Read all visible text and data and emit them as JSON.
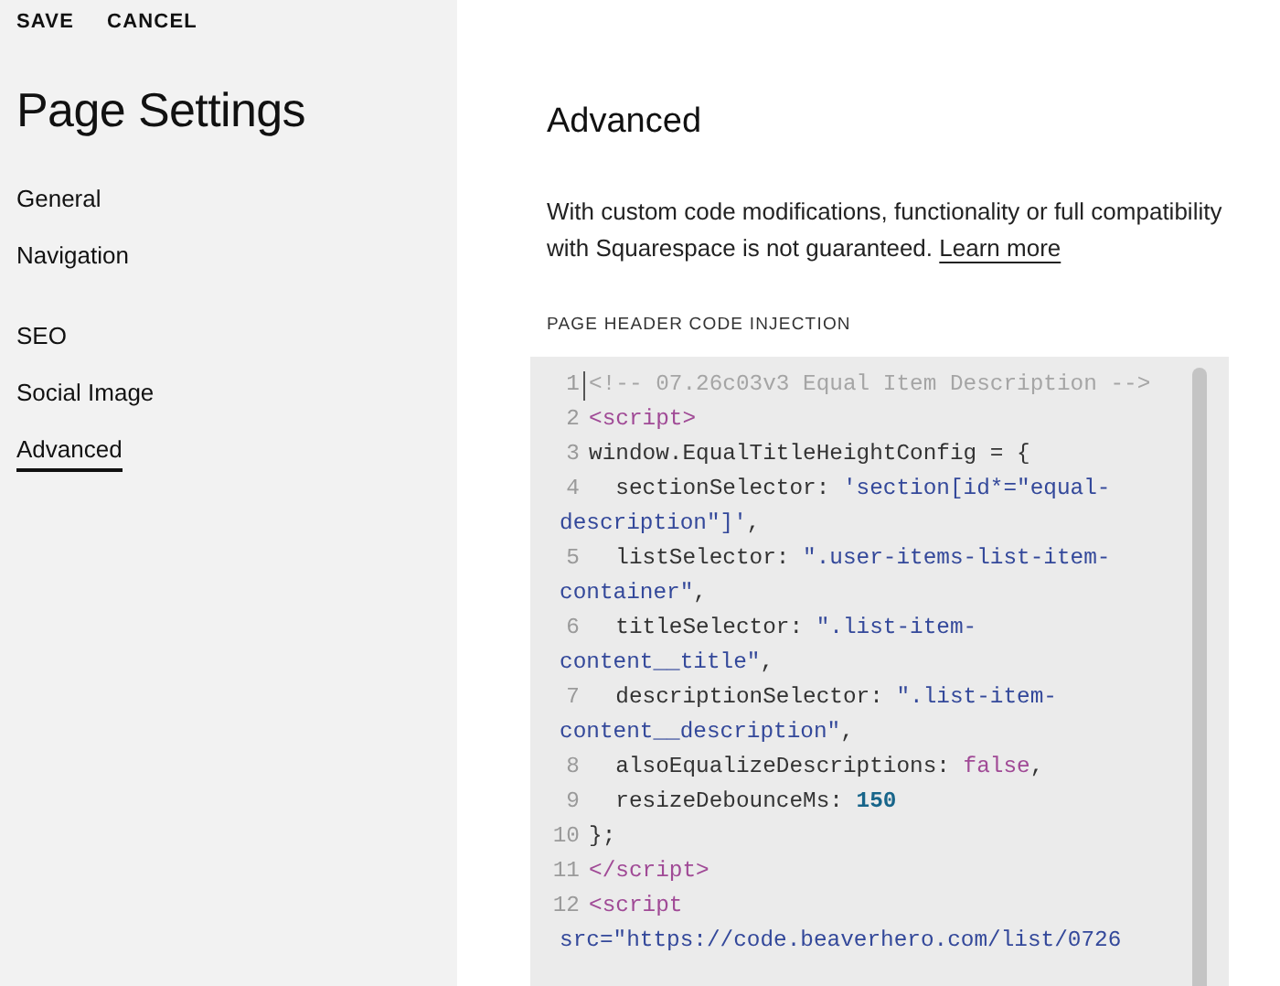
{
  "sidebar": {
    "actions": [
      "SAVE",
      "CANCEL"
    ],
    "title": "Page Settings",
    "groups": [
      [
        {
          "label": "General",
          "selected": false
        },
        {
          "label": "Navigation",
          "selected": false
        }
      ],
      [
        {
          "label": "SEO",
          "selected": false
        },
        {
          "label": "Social Image",
          "selected": false
        },
        {
          "label": "Advanced",
          "selected": true
        }
      ]
    ]
  },
  "main": {
    "title": "Advanced",
    "description": "With custom code modifications, functionality or full compatibility with Squarespace is not guaranteed.",
    "link": "Learn more",
    "section_label": "PAGE HEADER CODE INJECTION",
    "code": [
      {
        "number": "1",
        "rows": [
          {
            "tokens": [
              {
                "kind": "comment",
                "text": "<!-- 07.26c03v3 Equal Item Description -->"
              }
            ]
          }
        ]
      },
      {
        "number": "2",
        "rows": [
          {
            "tokens": [
              {
                "kind": "tag",
                "text": "<script>"
              }
            ]
          }
        ]
      },
      {
        "number": "3",
        "rows": [
          {
            "tokens": [
              {
                "kind": "plain",
                "text": "window.EqualTitleHeightConfig = {"
              }
            ]
          }
        ]
      },
      {
        "number": "4",
        "rows": [
          {
            "tokens": [
              {
                "kind": "plain",
                "text": "  sectionSelector: "
              },
              {
                "kind": "string",
                "text": "'section[id*=\"equal-"
              }
            ]
          },
          {
            "tokens": [
              {
                "kind": "string",
                "text": "description\"]'"
              },
              {
                "kind": "plain",
                "text": ","
              }
            ]
          }
        ]
      },
      {
        "number": "5",
        "rows": [
          {
            "tokens": [
              {
                "kind": "plain",
                "text": "  listSelector: "
              },
              {
                "kind": "string",
                "text": "\".user-items-list-item-"
              }
            ]
          },
          {
            "tokens": [
              {
                "kind": "string",
                "text": "container\""
              },
              {
                "kind": "plain",
                "text": ","
              }
            ]
          }
        ]
      },
      {
        "number": "6",
        "rows": [
          {
            "tokens": [
              {
                "kind": "plain",
                "text": "  titleSelector: "
              },
              {
                "kind": "string",
                "text": "\".list-item-"
              }
            ]
          },
          {
            "tokens": [
              {
                "kind": "string",
                "text": "content__title\""
              },
              {
                "kind": "plain",
                "text": ","
              }
            ]
          }
        ]
      },
      {
        "number": "7",
        "rows": [
          {
            "tokens": [
              {
                "kind": "plain",
                "text": "  descriptionSelector: "
              },
              {
                "kind": "string",
                "text": "\".list-item-"
              }
            ]
          },
          {
            "tokens": [
              {
                "kind": "string",
                "text": "content__description\""
              },
              {
                "kind": "plain",
                "text": ","
              }
            ]
          }
        ]
      },
      {
        "number": "8",
        "rows": [
          {
            "tokens": [
              {
                "kind": "plain",
                "text": "  alsoEqualizeDescriptions: "
              },
              {
                "kind": "keyword",
                "text": "false"
              },
              {
                "kind": "plain",
                "text": ","
              }
            ]
          }
        ]
      },
      {
        "number": "9",
        "rows": [
          {
            "tokens": [
              {
                "kind": "plain",
                "text": "  resizeDebounceMs: "
              },
              {
                "kind": "number",
                "text": "150"
              }
            ]
          }
        ]
      },
      {
        "number": "10",
        "rows": [
          {
            "tokens": [
              {
                "kind": "plain",
                "text": "};"
              }
            ]
          }
        ]
      },
      {
        "number": "11",
        "rows": [
          {
            "tokens": [
              {
                "kind": "tag",
                "text": "</script>"
              }
            ]
          }
        ]
      },
      {
        "number": "12",
        "rows": [
          {
            "tokens": [
              {
                "kind": "tag",
                "text": "<script"
              }
            ]
          },
          {
            "tokens": [
              {
                "kind": "attr",
                "text": "src="
              },
              {
                "kind": "string",
                "text": "\"https://code.beaverhero.com/list/0726"
              }
            ]
          }
        ]
      }
    ]
  }
}
